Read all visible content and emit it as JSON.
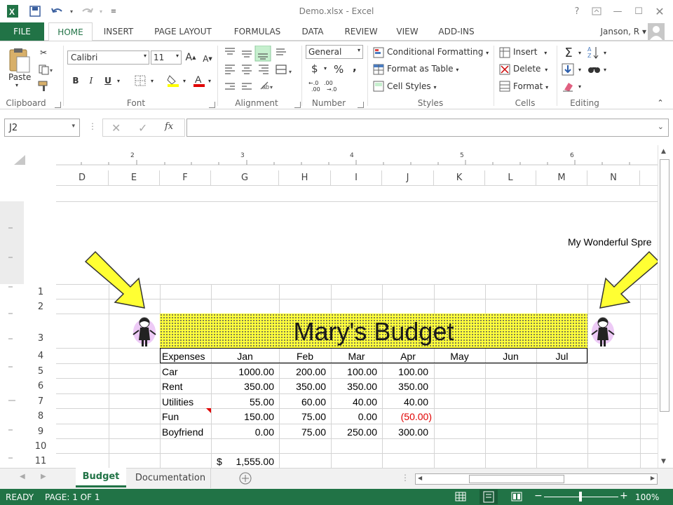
{
  "app": {
    "title": "Demo.xlsx - Excel",
    "user": "Janson, R"
  },
  "tabs": [
    "FILE",
    "HOME",
    "INSERT",
    "PAGE LAYOUT",
    "FORMULAS",
    "DATA",
    "REVIEW",
    "VIEW",
    "ADD-INS"
  ],
  "ribbon": {
    "clipboard": {
      "paste_label": "Paste",
      "group_label": "Clipboard"
    },
    "font": {
      "font_name": "Calibri",
      "font_size": "11",
      "group_label": "Font"
    },
    "alignment": {
      "group_label": "Alignment"
    },
    "number": {
      "format": "General",
      "currency_symbol": "$",
      "percent_symbol": "%",
      "comma_symbol": ",",
      "group_label": "Number"
    },
    "styles": {
      "conditional_formatting": "Conditional Formatting",
      "format_as_table": "Format as Table",
      "cell_styles": "Cell Styles",
      "group_label": "Styles"
    },
    "cells": {
      "insert": "Insert",
      "delete": "Delete",
      "format": "Format",
      "group_label": "Cells"
    },
    "editing": {
      "group_label": "Editing"
    }
  },
  "formula_bar": {
    "name_box": "J2",
    "fx_label": "fx",
    "content": ""
  },
  "ruler": {
    "marks": [
      "2",
      "3",
      "4",
      "5",
      "6"
    ]
  },
  "columns": [
    "D",
    "E",
    "F",
    "G",
    "H",
    "I",
    "J",
    "K",
    "L",
    "M",
    "N"
  ],
  "rows": [
    "1",
    "2",
    "3",
    "4",
    "5",
    "6",
    "7",
    "8",
    "9",
    "10",
    "11"
  ],
  "page_header_text": "My Wonderful Spre",
  "budget": {
    "title": "Mary's Budget",
    "header_label": "Expenses",
    "months": [
      "Jan",
      "Feb",
      "Mar",
      "Apr",
      "May",
      "Jun",
      "Jul"
    ],
    "rows": [
      {
        "label": "Car",
        "values": [
          "1000.00",
          "200.00",
          "100.00",
          "100.00"
        ]
      },
      {
        "label": "Rent",
        "values": [
          "350.00",
          "350.00",
          "350.00",
          "350.00"
        ]
      },
      {
        "label": "Utilities",
        "values": [
          "55.00",
          "60.00",
          "40.00",
          "40.00"
        ]
      },
      {
        "label": "Fun",
        "values": [
          "150.00",
          "75.00",
          "0.00",
          "(50.00)"
        ]
      },
      {
        "label": "Boyfriend",
        "values": [
          "0.00",
          "75.00",
          "250.00",
          "300.00"
        ]
      }
    ],
    "total_symbol": "$",
    "total_value": "1,555.00"
  },
  "sheet_tabs": [
    "Budget",
    "Documentation"
  ],
  "status": {
    "mode": "READY",
    "page": "PAGE: 1 OF 1",
    "zoom": "100%"
  },
  "colors": {
    "excel_green": "#217346",
    "title_fill": "#ffff3c",
    "negative": "#e00000",
    "arrow": "#ffff33"
  }
}
